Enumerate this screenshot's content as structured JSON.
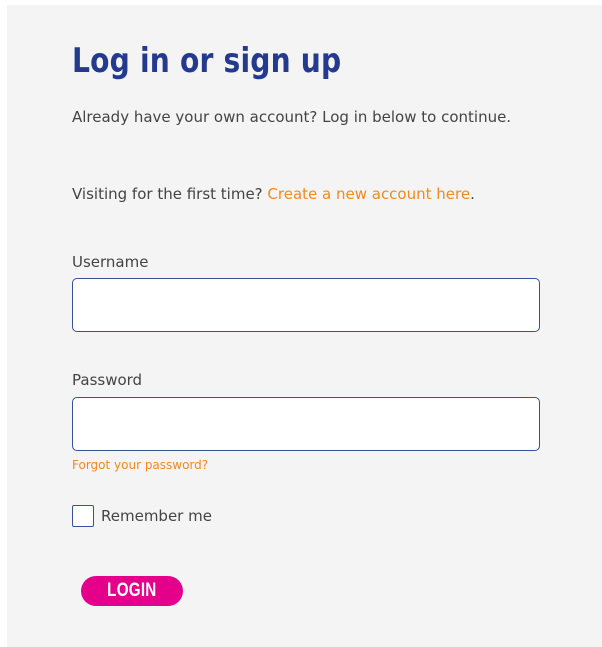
{
  "heading": "Log in or sign up",
  "intro_text": "Already have your own account? Log in below to continue.",
  "visiting_text": "Visiting for the first time? ",
  "create_account_link": "Create a new account here",
  "visiting_suffix": ".",
  "form": {
    "username_label": "Username",
    "username_value": "",
    "password_label": "Password",
    "password_value": "",
    "forgot_password_link": "Forgot your password?",
    "remember_me_label": "Remember me",
    "remember_me_checked": false,
    "login_button": "LOGIN"
  },
  "colors": {
    "heading": "#243a8f",
    "link": "#f28a1e",
    "button": "#e5008c",
    "panel_background": "#f4f4f4",
    "input_border": "#3a4f9a"
  }
}
